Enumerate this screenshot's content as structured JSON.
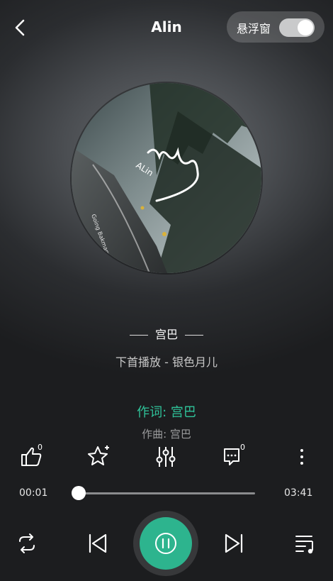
{
  "header": {
    "title": "Alin",
    "float_window_label": "悬浮窗",
    "float_window_on": true
  },
  "album": {
    "art_text": "ALin",
    "art_small_text": "Going Bakmam"
  },
  "song": {
    "artist": "宫巴",
    "next_up": "下首播放 - 银色月儿",
    "lyric_current": "作词: 宫巴",
    "lyric_next": "作曲: 宫巴"
  },
  "actions": {
    "like_count": "0",
    "comment_count": "0"
  },
  "progress": {
    "current": "00:01",
    "total": "03:41",
    "fraction": 0.005
  },
  "colors": {
    "accent": "#2db48e",
    "lyric_active": "#2fc39a"
  }
}
